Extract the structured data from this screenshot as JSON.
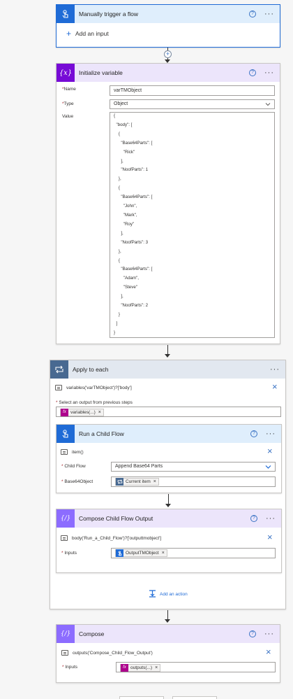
{
  "trigger": {
    "title": "Manually trigger a flow",
    "add_input_label": "Add an input",
    "help": "?",
    "more": "···"
  },
  "init_var": {
    "title": "Initialize variable",
    "help": "?",
    "more": "···",
    "name_label": "Name",
    "name_value": "varTMObject",
    "type_label": "Type",
    "type_value": "Object",
    "value_label": "Value",
    "value_lines": [
      "{",
      "  \"body\": [",
      "    {",
      "      \"Base64Parts\": [",
      "        \"Rick\"",
      "      ],",
      "      \"NoofParts\": 1",
      "    },",
      "    {",
      "      \"Base64Parts\": [",
      "        \"John\",",
      "        \"Mark\",",
      "        \"Roy\"",
      "      ],",
      "      \"NoofParts\": 3",
      "    },",
      "    {",
      "      \"Base64Parts\": [",
      "        \"Adam\",",
      "        \"Steve\"",
      "      ],",
      "      \"NoofParts\": 2",
      "    }",
      "  ]",
      "}"
    ]
  },
  "apply_each": {
    "title": "Apply to each",
    "more": "···",
    "expression": "variables('varTMObject')?['body']",
    "select_label": "Select an output from previous steps",
    "token_label": "variables(...)",
    "add_action_label": "Add an action"
  },
  "child_flow": {
    "title": "Run a Child Flow",
    "help": "?",
    "more": "···",
    "expression": "item()",
    "child_flow_label": "Child Flow",
    "child_flow_value": "Append Base64 Parts",
    "base64_label": "Base64Object",
    "base64_token": "Current item"
  },
  "compose_child": {
    "title": "Compose Child Flow Output",
    "help": "?",
    "more": "···",
    "expression": "body('Run_a_Child_Flow')?['outputtmobject']",
    "inputs_label": "Inputs",
    "inputs_token": "OutputTMObject"
  },
  "compose": {
    "title": "Compose",
    "help": "?",
    "more": "···",
    "expression": "outputs('Compose_Child_Flow_Output')",
    "inputs_label": "Inputs",
    "inputs_token": "outputs(...)"
  },
  "glyphs": {
    "req": "*",
    "close": "×",
    "plus": "+",
    "fx": "fx",
    "chevron": "⌄"
  },
  "colors": {
    "trigger_header": "#dfeefc",
    "trigger_icon": "#1f6bd6",
    "variable_header": "#ece5fb",
    "variable_icon": "#770bd6",
    "compose_icon": "#8c6cff",
    "loop_header": "#e2e8f0",
    "loop_icon": "#486991",
    "expression_token": "#ad008c"
  }
}
